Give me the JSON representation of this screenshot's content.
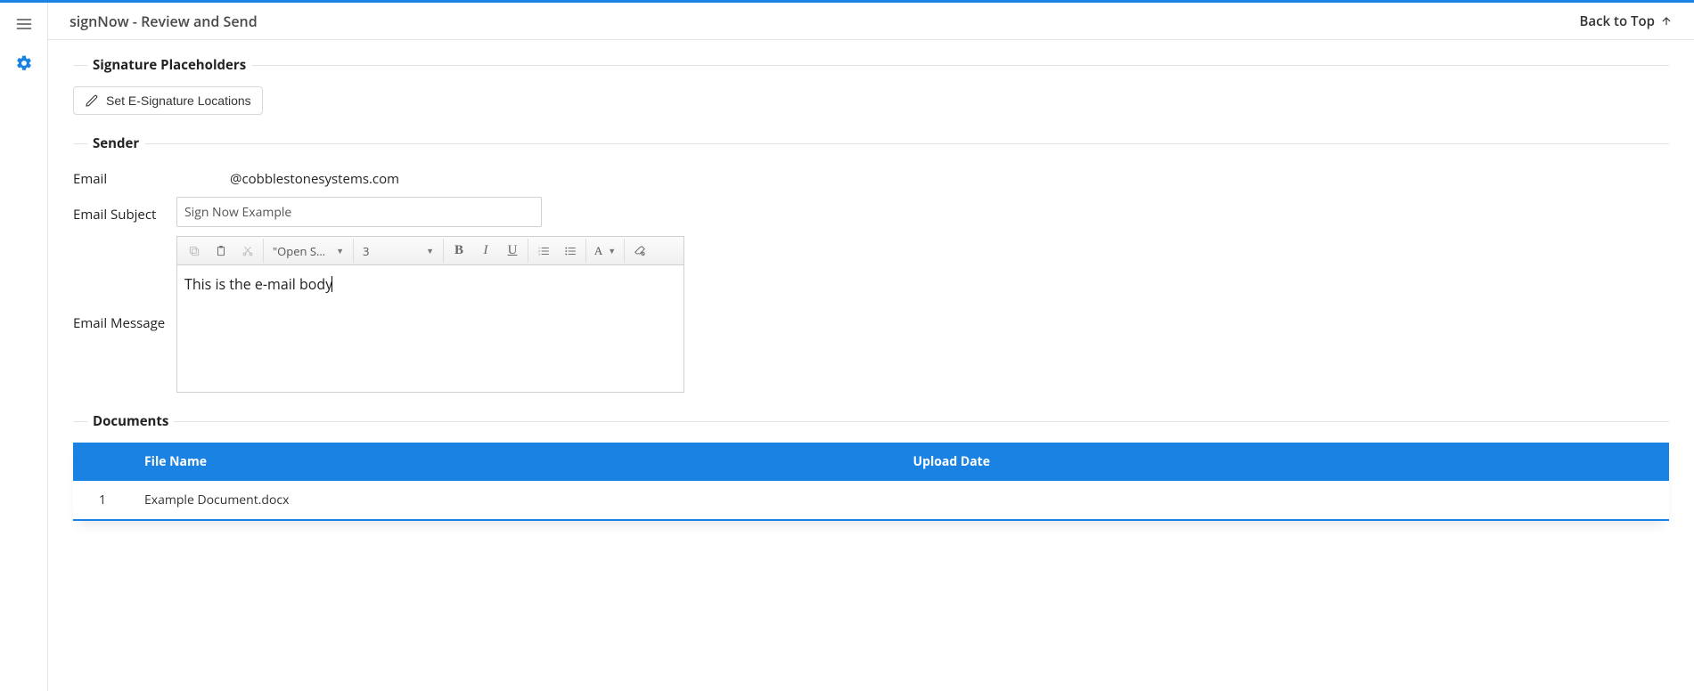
{
  "header": {
    "title": "signNow - Review and Send",
    "back_to_top": "Back to Top"
  },
  "sections": {
    "placeholders": {
      "legend": "Signature Placeholders",
      "button_label": "Set E-Signature Locations"
    },
    "sender": {
      "legend": "Sender",
      "email_label": "Email",
      "email_value": "@cobblestonesystems.com",
      "subject_label": "Email Subject",
      "subject_value": "Sign Now Example",
      "message_label": "Email Message",
      "editor": {
        "font_family": "\"Open Sa…",
        "font_size": "3",
        "body": "This is the e-mail body"
      }
    },
    "documents": {
      "legend": "Documents",
      "columns": {
        "name": "File Name",
        "date": "Upload Date"
      },
      "rows": [
        {
          "idx": "1",
          "name": "Example Document.docx",
          "date": ""
        }
      ]
    }
  }
}
